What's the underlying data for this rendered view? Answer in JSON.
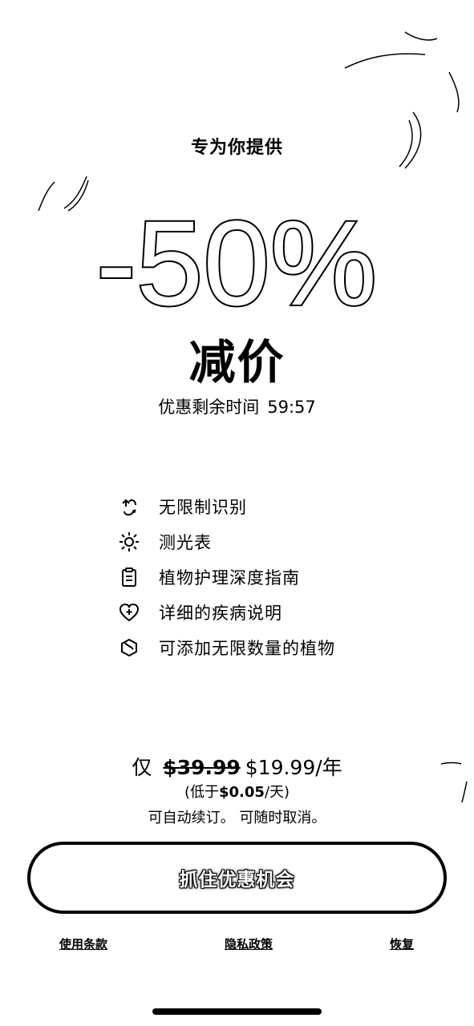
{
  "offer": {
    "title": "专为你提供",
    "discount": "-50%",
    "discount_label": "减价",
    "timer_label": "优惠剩余时间",
    "timer_value": "59:57"
  },
  "features": [
    {
      "icon": "recognition-icon",
      "label": "无限制识别"
    },
    {
      "icon": "sun-icon",
      "label": "测光表"
    },
    {
      "icon": "clipboard-icon",
      "label": "植物护理深度指南"
    },
    {
      "icon": "heart-plus-icon",
      "label": "详细的疾病说明"
    },
    {
      "icon": "seed-icon",
      "label": "可添加无限数量的植物"
    }
  ],
  "pricing": {
    "prefix": "仅",
    "old_price": "$39.99",
    "new_price": "$19.99/年",
    "per_day_open": "(低于",
    "per_day_value": "$0.05",
    "per_day_close": "/天)",
    "renew_note": "可自动续订。 可随时取消。"
  },
  "cta": {
    "label": "抓住优惠机会"
  },
  "footer": {
    "terms": "使用条款",
    "privacy": "隐私政策",
    "restore": "恢复"
  }
}
